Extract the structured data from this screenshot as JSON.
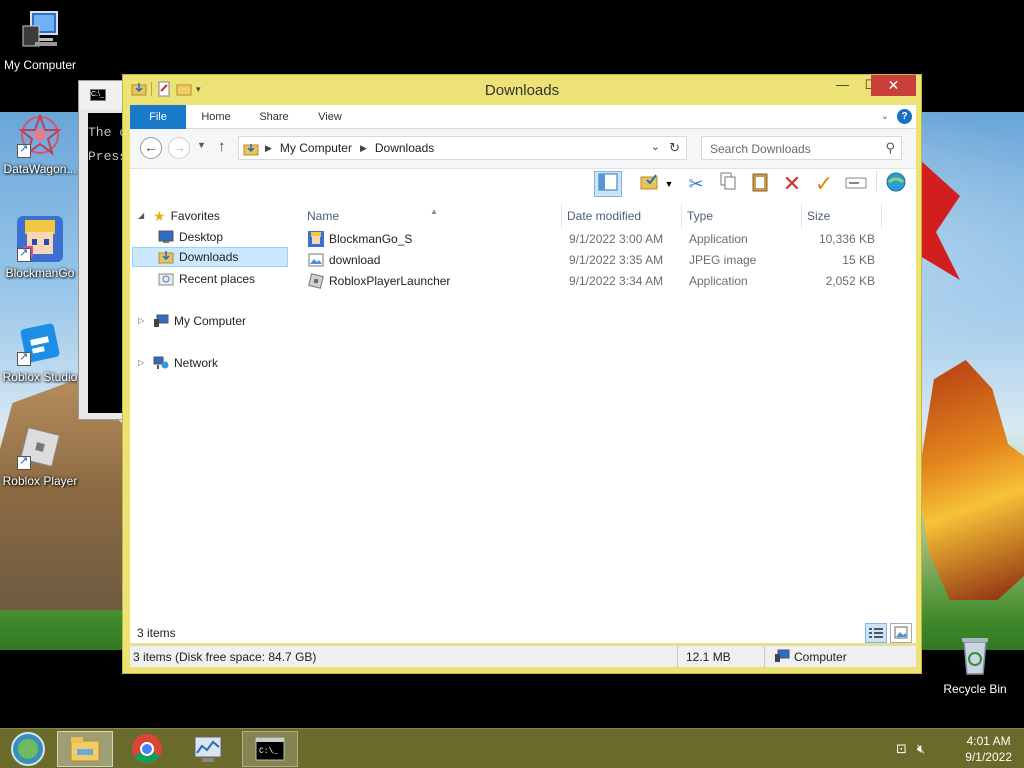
{
  "desktop": {
    "icons": [
      {
        "label": "My Computer",
        "icon": "computer-icon"
      },
      {
        "label": "DataWagon...",
        "icon": "datawagon-icon"
      },
      {
        "label": "BlockmanGo",
        "icon": "blockmango-icon"
      },
      {
        "label": "Roblox Studio",
        "icon": "roblox-studio-icon"
      },
      {
        "label": "Roblox Player",
        "icon": "roblox-player-icon"
      },
      {
        "label": "Recycle Bin",
        "icon": "recycle-bin-icon"
      }
    ]
  },
  "console": {
    "icon_text": "C:\\_",
    "lines": [
      "The c",
      "Press"
    ]
  },
  "explorer": {
    "title": "Downloads",
    "window_buttons": {
      "minimize": "—",
      "maximize": "☐",
      "close": "✕"
    },
    "ribbon_tabs": [
      "File",
      "Home",
      "Share",
      "View"
    ],
    "help": "?",
    "address": {
      "crumbs": [
        "My Computer",
        "Downloads"
      ],
      "search_placeholder": "Search Downloads"
    },
    "nav_pane": {
      "favorites": "Favorites",
      "desktop": "Desktop",
      "downloads": "Downloads",
      "recent_places": "Recent places",
      "my_computer": "My Computer",
      "network": "Network"
    },
    "columns": [
      "Name",
      "Date modified",
      "Type",
      "Size"
    ],
    "files": [
      {
        "name": "BlockmanGo_S",
        "date": "9/1/2022 3:00 AM",
        "type": "Application",
        "size": "10,336 KB",
        "icon": "blockmango-app-icon"
      },
      {
        "name": "download",
        "date": "9/1/2022 3:35 AM",
        "type": "JPEG image",
        "size": "15 KB",
        "icon": "image-file-icon"
      },
      {
        "name": "RobloxPlayerLauncher",
        "date": "9/1/2022 3:34 AM",
        "type": "Application",
        "size": "2,052 KB",
        "icon": "roblox-launcher-icon"
      }
    ],
    "item_count": "3 items",
    "status": {
      "summary": "3 items (Disk free space: 84.7 GB)",
      "size": "12.1 MB",
      "location": "Computer"
    }
  },
  "taskbar": {
    "time": "4:01 AM",
    "date": "9/1/2022"
  }
}
